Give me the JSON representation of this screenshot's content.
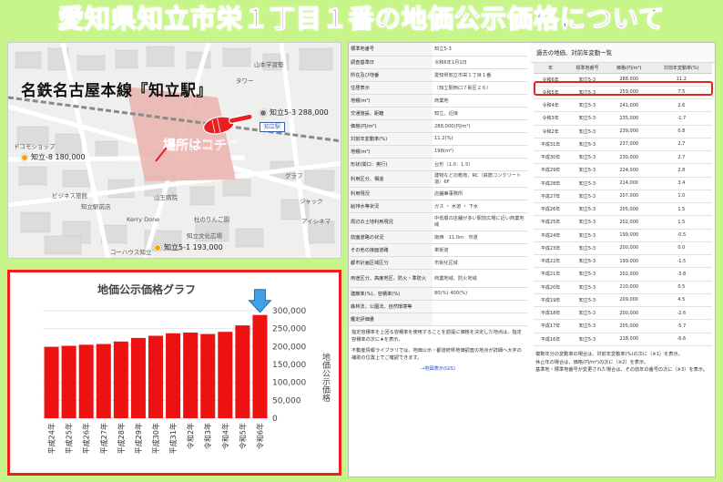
{
  "title": "愛知県知立市栄１丁目１番の地価公示価格について",
  "map": {
    "caption": "名鉄名古屋本線『知立駅』",
    "here_label": "場所はコチラ",
    "station_label": "知立駅",
    "pins": [
      {
        "label": "知立5-3  288,000"
      },
      {
        "label": "知立-8  180,000"
      },
      {
        "label": "知立5-1  193,000"
      }
    ],
    "places": [
      "山本学習塾",
      "ドコモショップ",
      "グラフ",
      "知立文化広場",
      "山王病院",
      "杜のりんご園",
      "ビジネス旅館",
      "知立駅前店",
      "コーハウス知立",
      "ジャック",
      "アイシネマ",
      "タワー",
      "Kerry Done"
    ]
  },
  "chart_data": {
    "type": "bar",
    "title": "地価公示価格グラフ",
    "ylabel": "地価公示価格",
    "categories": [
      "平成24年",
      "平成25年",
      "平成26年",
      "平成27年",
      "平成28年",
      "平成29年",
      "平成30年",
      "平成31年",
      "令和2年",
      "令和3年",
      "令和4年",
      "令和5年",
      "令和6年"
    ],
    "values": [
      199000,
      202000,
      205000,
      207000,
      214000,
      224000,
      230000,
      237000,
      239000,
      235000,
      241000,
      259000,
      288000
    ],
    "ylim": [
      0,
      300000
    ],
    "yticks": [
      "300,000",
      "250,000",
      "200,000",
      "150,000",
      "100,000",
      "50,000",
      "0"
    ],
    "bar_color": "#ee1111",
    "arrow_color": "#3fa0e8"
  },
  "info_table": [
    {
      "k": "標準地番号",
      "v": "知立5-3"
    },
    {
      "k": "調査基準日",
      "v": "令和6年1月1日"
    },
    {
      "k": "所在及び地番",
      "v": "愛知県知立市栄１丁目１番"
    },
    {
      "k": "住居表示",
      "v": "（知立駅西口７街区２６）"
    },
    {
      "k": "地積(m²)",
      "v": "商業地"
    },
    {
      "k": "交通施設、距離",
      "v": "知立、近接"
    },
    {
      "k": "価格(円/m²)",
      "v": "288,000(円/m²)"
    },
    {
      "k": "対前年変動率(%)",
      "v": "11.2(%)"
    },
    {
      "k": "地積(m²)",
      "v": "198(m²)"
    },
    {
      "k": "形状(間口：奥行)",
      "v": "台形（1.0：1.5）"
    },
    {
      "k": "利用区分、構造",
      "v": "建物などの敷地、RC（鉄筋コンクリート造）6F"
    },
    {
      "k": "利用現況",
      "v": "店舗兼事務所"
    },
    {
      "k": "給排水等状況",
      "v": "ガス ・ 水道 ・ 下水"
    },
    {
      "k": "周辺の土地利用現況",
      "v": "中低層の店舗が多い駅前広場に近い商業地域"
    },
    {
      "k": "前面道路の状況",
      "v": "南西　11.0m　市道"
    },
    {
      "k": "その他の接面道路",
      "v": "単街道"
    },
    {
      "k": "都市計画区域区分",
      "v": "市街化区域"
    },
    {
      "k": "用途区分、高度地区、防火・準防火",
      "v": "商業地域、防火地域"
    },
    {
      "k": "建蔽率(%)、容積率(%)",
      "v": "80(%) 400(%)"
    },
    {
      "k": "森林法、公園法、自然環境等",
      "v": ""
    },
    {
      "k": "鑑定評価書",
      "v": ""
    }
  ],
  "info_notes": [
    "指定容積率を上回る容積率を使用することを前提に価格を決定した地点は、指定容積率の次に★を表示。",
    "不動産情報ライブラリでは、地価公示・都道府県地価調査の地点が詳細へ大字の補助の位置上でご確認できます。"
  ],
  "info_link": "→地図表示(GIS)",
  "past": {
    "title": "過去の地価、対前年変動一覧",
    "headers": [
      "年",
      "標準地番号",
      "価格(円/m²)",
      "対前年変動率(%)"
    ],
    "rows": [
      [
        "令和6年",
        "知立5-3",
        "288,000",
        "11.2"
      ],
      [
        "令和5年",
        "知立5-3",
        "259,000",
        "7.5"
      ],
      [
        "令和4年",
        "知立5-3",
        "241,000",
        "2.6"
      ],
      [
        "令和3年",
        "知立5-3",
        "235,000",
        "-1.7"
      ],
      [
        "令和2年",
        "知立5-3",
        "239,000",
        "0.8"
      ],
      [
        "平成31年",
        "知立5-3",
        "237,000",
        "2.7"
      ],
      [
        "平成30年",
        "知立5-3",
        "230,000",
        "2.7"
      ],
      [
        "平成29年",
        "知立5-3",
        "224,000",
        "2.8"
      ],
      [
        "平成28年",
        "知立5-3",
        "214,000",
        "3.4"
      ],
      [
        "平成27年",
        "知立5-3",
        "207,000",
        "1.0"
      ],
      [
        "平成26年",
        "知立5-3",
        "205,000",
        "1.5"
      ],
      [
        "平成25年",
        "知立5-3",
        "202,000",
        "1.5"
      ],
      [
        "平成24年",
        "知立5-3",
        "199,000",
        "-0.5"
      ],
      [
        "平成23年",
        "知立5-3",
        "200,000",
        "0.0"
      ],
      [
        "平成22年",
        "知立5-3",
        "199,000",
        "-1.5"
      ],
      [
        "平成21年",
        "知立5-3",
        "202,000",
        "-3.8"
      ],
      [
        "平成20年",
        "知立5-3",
        "210,000",
        "0.5"
      ],
      [
        "平成19年",
        "知立5-3",
        "209,000",
        "4.5"
      ],
      [
        "平成18年",
        "知立5-3",
        "200,000",
        "-2.6"
      ],
      [
        "平成17年",
        "知立5-3",
        "205,000",
        "-5.7"
      ],
      [
        "平成16年",
        "知立5-3",
        "218,000",
        "-6.6"
      ]
    ],
    "notes": [
      "複数年分の変動率の場合は、対前年変動率(%)の次に（※1）を表示。",
      "休止年の場合は、価格(円/m²)の次に（※2）を表示。",
      "基準地・標準地番号が変更された場合は、その前年の番号の次に（※3）を表示。"
    ]
  }
}
